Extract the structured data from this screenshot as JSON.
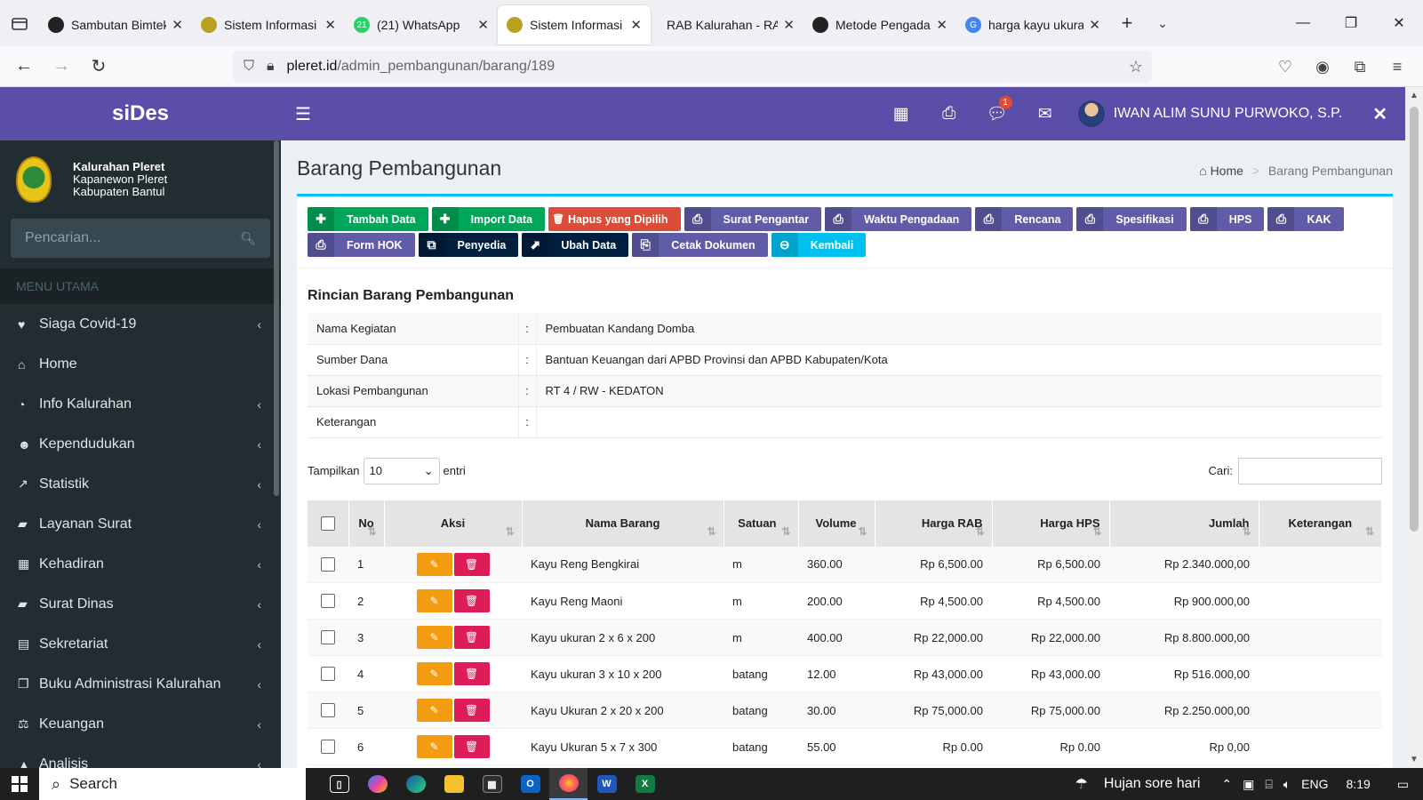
{
  "browser": {
    "tabs": [
      {
        "title": "Sambutan Bimtek",
        "fav_color": "#222222",
        "active": false
      },
      {
        "title": "Sistem Informasi K",
        "fav_color": "#b8a020",
        "active": false
      },
      {
        "title": "(21) WhatsApp",
        "fav_color": "#25d366",
        "fav_text": "21",
        "active": false
      },
      {
        "title": "Sistem Informasi K",
        "fav_color": "#b8a020",
        "active": true
      },
      {
        "title": "RAB Kalurahan - RAB",
        "fav_color": "",
        "active": false
      },
      {
        "title": "Metode Pengadaa",
        "fav_color": "#222222",
        "active": false
      },
      {
        "title": "harga kayu ukuran",
        "fav_color": "#4285f4",
        "fav_text": "G",
        "active": false
      }
    ],
    "url_domain": "pleret.id",
    "url_path": "/admin_pembangunan/barang/189"
  },
  "sidebar": {
    "brand": "siDes",
    "org_line1": "Kalurahan Pleret",
    "org_line2": "Kapanewon Pleret",
    "org_line3": "Kabupaten Bantul",
    "search_placeholder": "Pencarian...",
    "menu_header": "MENU UTAMA",
    "items": [
      {
        "label": "Siaga Covid-19",
        "icon": "heartbeat-icon",
        "glyph": "♥",
        "arrow": true
      },
      {
        "label": "Home",
        "icon": "home-icon",
        "glyph": "⌂",
        "arrow": false
      },
      {
        "label": "Info Kalurahan",
        "icon": "dashboard-icon",
        "glyph": "◔",
        "arrow": true
      },
      {
        "label": "Kependudukan",
        "icon": "users-icon",
        "glyph": "☻",
        "arrow": true
      },
      {
        "label": "Statistik",
        "icon": "chart-line-icon",
        "glyph": "↗",
        "arrow": true
      },
      {
        "label": "Layanan Surat",
        "icon": "book-icon",
        "glyph": "▰",
        "arrow": true
      },
      {
        "label": "Kehadiran",
        "icon": "calendar-check-icon",
        "glyph": "▦",
        "arrow": true
      },
      {
        "label": "Surat Dinas",
        "icon": "book-icon",
        "glyph": "▰",
        "arrow": true
      },
      {
        "label": "Sekretariat",
        "icon": "archive-icon",
        "glyph": "▤",
        "arrow": true
      },
      {
        "label": "Buku Administrasi Kalurahan",
        "icon": "copy-icon",
        "glyph": "❐",
        "arrow": true
      },
      {
        "label": "Keuangan",
        "icon": "balance-scale-icon",
        "glyph": "⚖",
        "arrow": true
      },
      {
        "label": "Analisis",
        "icon": "analysis-icon",
        "glyph": "▲",
        "arrow": true
      }
    ]
  },
  "header": {
    "user_name": "IWAN ALIM SUNU PURWOKO, S.P.",
    "notif_count": "1"
  },
  "page": {
    "title": "Barang Pembangunan",
    "breadcrumb_home": "Home",
    "breadcrumb_current": "Barang Pembangunan"
  },
  "toolbar": [
    {
      "label": "Tambah Data",
      "color": "green",
      "glyph": "✚",
      "icon": "plus-icon",
      "name": "tambah-data-button"
    },
    {
      "label": "Import Data",
      "color": "green",
      "glyph": "✚",
      "icon": "plus-icon",
      "name": "import-data-button"
    },
    {
      "label": "Hapus yang Dipilih",
      "color": "red",
      "glyph": "🗑",
      "icon": "trash-icon",
      "name": "hapus-dipilih-button",
      "inline": true
    },
    {
      "label": "Surat Pengantar",
      "color": "purple",
      "glyph": "⎙",
      "icon": "print-icon",
      "name": "surat-pengantar-button"
    },
    {
      "label": "Waktu Pengadaan",
      "color": "purple",
      "glyph": "⎙",
      "icon": "print-icon",
      "name": "waktu-pengadaan-button"
    },
    {
      "label": "Rencana",
      "color": "purple",
      "glyph": "⎙",
      "icon": "print-icon",
      "name": "rencana-button"
    },
    {
      "label": "Spesifikasi",
      "color": "purple",
      "glyph": "⎙",
      "icon": "print-icon",
      "name": "spesifikasi-button"
    },
    {
      "label": "HPS",
      "color": "purple",
      "glyph": "⎙",
      "icon": "print-icon",
      "name": "hps-button"
    },
    {
      "label": "KAK",
      "color": "purple",
      "glyph": "⎙",
      "icon": "print-icon",
      "name": "kak-button"
    },
    {
      "label": "Form HOK",
      "color": "purple",
      "glyph": "⎙",
      "icon": "print-icon",
      "name": "form-hok-button"
    },
    {
      "label": "Penyedia",
      "color": "navy",
      "glyph": "⧉",
      "icon": "external-link-icon",
      "name": "penyedia-button"
    },
    {
      "label": "Ubah Data",
      "color": "navy",
      "glyph": "⬈",
      "icon": "edit-square-icon",
      "name": "ubah-data-button"
    },
    {
      "label": "Cetak Dokumen",
      "color": "purple",
      "glyph": "⎘",
      "icon": "file-pdf-icon",
      "name": "cetak-dokumen-button"
    },
    {
      "label": "Kembali",
      "color": "blue",
      "glyph": "⊖",
      "icon": "arrow-circle-left-icon",
      "name": "kembali-button"
    }
  ],
  "detail": {
    "title": "Rincian Barang Pembangunan",
    "separator": ":",
    "rows": [
      {
        "label": "Nama Kegiatan",
        "value": "Pembuatan Kandang Domba"
      },
      {
        "label": "Sumber Dana",
        "value": "Bantuan Keuangan dari APBD Provinsi dan APBD Kabupaten/Kota"
      },
      {
        "label": "Lokasi Pembangunan",
        "value": "RT 4 / RW - KEDATON"
      },
      {
        "label": "Keterangan",
        "value": ""
      }
    ]
  },
  "table_controls": {
    "show_label": "Tampilkan",
    "show_value": "10",
    "entries_label": "entri",
    "search_label": "Cari:"
  },
  "table": {
    "headers": [
      "No",
      "Aksi",
      "Nama Barang",
      "Satuan",
      "Volume",
      "Harga RAB",
      "Harga HPS",
      "Jumlah",
      "Keterangan"
    ],
    "rows": [
      {
        "no": "1",
        "nama": "Kayu Reng Bengkirai",
        "satuan": "m",
        "volume": "360.00",
        "rab": "Rp 6,500.00",
        "hps": "Rp 6,500.00",
        "jumlah": "Rp 2.340.000,00",
        "ket": ""
      },
      {
        "no": "2",
        "nama": "Kayu Reng Maoni",
        "satuan": "m",
        "volume": "200.00",
        "rab": "Rp 4,500.00",
        "hps": "Rp 4,500.00",
        "jumlah": "Rp 900.000,00",
        "ket": ""
      },
      {
        "no": "3",
        "nama": "Kayu ukuran 2 x 6 x 200",
        "satuan": "m",
        "volume": "400.00",
        "rab": "Rp 22,000.00",
        "hps": "Rp 22,000.00",
        "jumlah": "Rp 8.800.000,00",
        "ket": ""
      },
      {
        "no": "4",
        "nama": "Kayu ukuran 3 x 10 x 200",
        "satuan": "batang",
        "volume": "12.00",
        "rab": "Rp 43,000.00",
        "hps": "Rp 43,000.00",
        "jumlah": "Rp 516.000,00",
        "ket": ""
      },
      {
        "no": "5",
        "nama": "Kayu Ukuran 2 x 20 x 200",
        "satuan": "batang",
        "volume": "30.00",
        "rab": "Rp 75,000.00",
        "hps": "Rp 75,000.00",
        "jumlah": "Rp 2.250.000,00",
        "ket": ""
      },
      {
        "no": "6",
        "nama": "Kayu Ukuran 5 x 7 x 300",
        "satuan": "batang",
        "volume": "55.00",
        "rab": "Rp 0.00",
        "hps": "Rp 0.00",
        "jumlah": "Rp 0,00",
        "ket": ""
      }
    ]
  },
  "taskbar": {
    "search_label": "Search",
    "weather": "Hujan sore hari",
    "lang": "ENG",
    "time": "8:19"
  },
  "colors": {
    "brand": "#5b4ea8",
    "sidebar": "#222d32",
    "accent": "#00c0ef"
  }
}
